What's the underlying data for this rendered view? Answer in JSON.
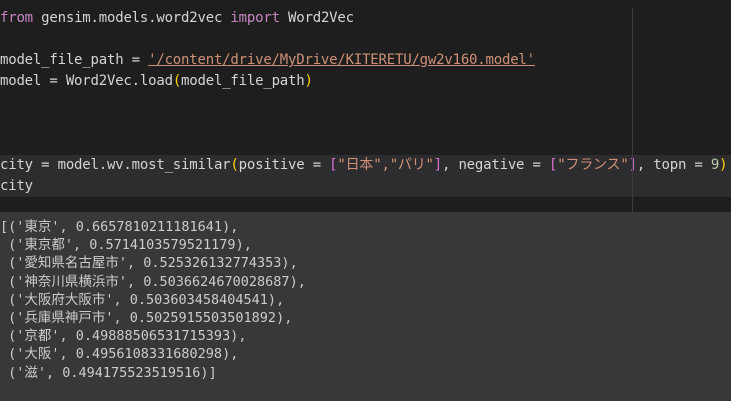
{
  "code": {
    "line1": {
      "kw_from": "from",
      "module": " gensim.models.word2vec ",
      "kw_import": "import",
      "name": " Word2Vec"
    },
    "line3": {
      "lhs": "model_file_path = ",
      "path": "'/content/drive/MyDrive/KITERETU/gw2v160.model'"
    },
    "line4": {
      "text_a": "model = Word2Vec.load",
      "paren_open": "(",
      "arg": "model_file_path",
      "paren_close": ")"
    },
    "line9": {
      "prefix": "city = model.wv.most_similar",
      "paren_open": "(",
      "pos_label": "positive = ",
      "br1_open": "[",
      "pos_items": "\"日本\",\"パリ\"",
      "br1_close": "]",
      "neg_label": ", negative = ",
      "br2_open": "[",
      "neg_items": "\"フランス\"",
      "br2_close": "]",
      "topn_label": ", topn = ",
      "topn_value": "9",
      "paren_close": ")"
    },
    "line10": "city"
  },
  "output": {
    "lines": [
      "[('東京', 0.6657810211181641),",
      " ('東京都', 0.5714103579521179),",
      " ('愛知県名古屋市', 0.525326132774353),",
      " ('神奈川県横浜市', 0.5036624670028687),",
      " ('大阪府大阪市', 0.503603458404541),",
      " ('兵庫県神戸市', 0.5025915503501892),",
      " ('京都', 0.49888506531715393),",
      " ('大阪', 0.4956108331680298),",
      " ('滋', 0.494175523519516)]"
    ]
  }
}
